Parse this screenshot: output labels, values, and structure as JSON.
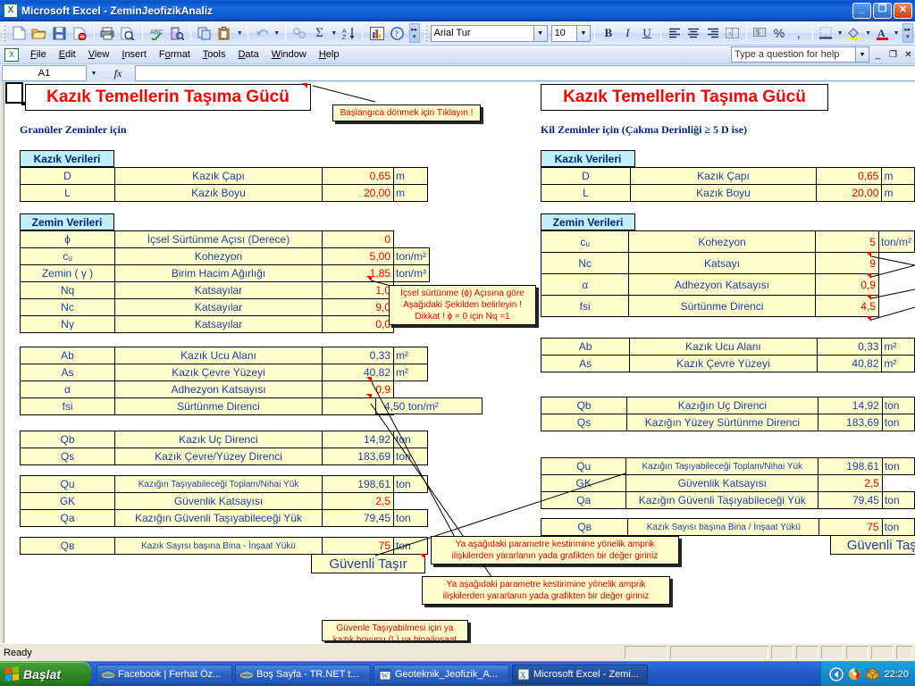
{
  "window": {
    "app_icon": "excel-icon",
    "title": "Microsoft Excel - ZeminJeofizikAnaliz",
    "minimize": "_",
    "restore": "❐",
    "close": "✕"
  },
  "toolbar": {
    "font_name": "Arial Tur",
    "font_size": "10",
    "bold": "B",
    "italic": "I",
    "underline": "U",
    "percent": "%",
    "comma": ",",
    "icons": [
      "new-document-icon",
      "open-folder-icon",
      "save-icon",
      "permission-icon",
      "print-icon",
      "print-preview-icon",
      "spelling-icon",
      "research-icon",
      "copy-icon",
      "paste-icon",
      "undo-icon",
      "hyperlink-icon",
      "autosum-icon",
      "sort-ascending-icon",
      "chart-wizard-icon",
      "help-icon"
    ]
  },
  "menubar": {
    "items": [
      {
        "label": "File",
        "accel": "F"
      },
      {
        "label": "Edit",
        "accel": "E"
      },
      {
        "label": "View",
        "accel": "V"
      },
      {
        "label": "Insert",
        "accel": "I"
      },
      {
        "label": "Format",
        "accel": "o"
      },
      {
        "label": "Tools",
        "accel": "T"
      },
      {
        "label": "Data",
        "accel": "D"
      },
      {
        "label": "Window",
        "accel": "W"
      },
      {
        "label": "Help",
        "accel": "H"
      }
    ],
    "ask_placeholder": "Type a question for help"
  },
  "formula_bar": {
    "name_box": "A1",
    "fx_label": "fx",
    "formula_value": ""
  },
  "sheet": {
    "left_panel": {
      "title": "Kazık Temellerin Taşıma Gücü",
      "subtitle": "Granüler Zeminler için",
      "pile_header": "Kazık Verileri",
      "pile_rows": [
        {
          "sym": "D",
          "desc": "Kazık Çapı",
          "val": "0,65",
          "unit": "m",
          "red": true
        },
        {
          "sym": "L",
          "desc": "Kazık Boyu",
          "val": "20,00",
          "unit": "m",
          "red": true
        }
      ],
      "soil_header": "Zemin Verileri",
      "soil_rows": [
        {
          "sym": "ϕ",
          "desc": "İçsel Sürtünme Açısı (Derece)",
          "val": "0",
          "unit": "",
          "red": true
        },
        {
          "sym": "cᵤ",
          "desc": "Kohezyon",
          "val": "5,00",
          "unit": "ton/m²",
          "red": true
        },
        {
          "sym": "Zemin ( γ )",
          "desc": "Birim Hacim Ağırlığı",
          "val": "1,85",
          "unit": "ton/m³",
          "red": true
        },
        {
          "sym": "Nq",
          "desc": "Katsayılar",
          "val": "1,0",
          "unit": "",
          "red": true
        },
        {
          "sym": "Nc",
          "desc": "Katsayılar",
          "val": "9,0",
          "unit": "",
          "red": true
        },
        {
          "sym": "Nγ",
          "desc": "Katsayılar",
          "val": "0,0",
          "unit": "",
          "red": true
        }
      ],
      "area_rows": [
        {
          "sym": "Ab",
          "desc": "Kazık Ucu Alanı",
          "val": "0,33",
          "unit": "m²",
          "red": false
        },
        {
          "sym": "As",
          "desc": "Kazık Çevre Yüzeyi",
          "val": "40,82",
          "unit": "m²",
          "red": false
        },
        {
          "sym": "α",
          "desc": "Adhezyon Katsayısı",
          "val": "0,9",
          "unit": "",
          "red": true
        },
        {
          "sym": "fsi",
          "desc": "Sürtünme Direnci",
          "val": "4,5",
          "unit": "",
          "red": true
        }
      ],
      "fsi_float": "4,50 ton/m²",
      "resist_rows": [
        {
          "sym": "Qb",
          "desc": "Kazık Uç Direnci",
          "val": "14,92",
          "unit": "ton",
          "red": false
        },
        {
          "sym": "Qs",
          "desc": "Kazık Çevre/Yüzey Direnci",
          "val": "183,69",
          "unit": "ton",
          "red": false
        }
      ],
      "capacity_rows": [
        {
          "sym": "Qu",
          "desc": "Kazığın Taşıyabileceği Toplam/Nihai Yük",
          "val": "198,61",
          "unit": "ton",
          "red": false,
          "small": true
        },
        {
          "sym": "GK",
          "desc": "Güvenlik Katsayısı",
          "val": "2,5",
          "unit": "",
          "red": true
        },
        {
          "sym": "Qa",
          "desc": "Kazığın Güvenli Taşıyabileceği Yük",
          "val": "79,45",
          "unit": "ton",
          "red": false
        }
      ],
      "building_row": {
        "sym": "Qʙ",
        "desc": "Kazık Sayısı başına Bina - İnşaat Yükü",
        "val": "75",
        "unit": "ton",
        "red": true,
        "small": true
      },
      "verdict": "Güvenli Taşır"
    },
    "right_panel": {
      "title": "Kazık Temellerin Taşıma Gücü",
      "subtitle": "Kil Zeminler için (Çakma Derinliği ≥ 5 D ise)",
      "pile_header": "Kazık Verileri",
      "pile_rows": [
        {
          "sym": "D",
          "desc": "Kazık Çapı",
          "val": "0,65",
          "unit": "m",
          "red": true
        },
        {
          "sym": "L",
          "desc": "Kazık Boyu",
          "val": "20,00",
          "unit": "m",
          "red": true
        }
      ],
      "soil_header": "Zemin Verileri",
      "soil_rows": [
        {
          "sym": "cᵤ",
          "desc": "Kohezyon",
          "val": "5",
          "unit": "ton/m²",
          "red": true
        },
        {
          "sym": "Nc",
          "desc": "Katsayı",
          "val": "9",
          "unit": "",
          "red": true
        },
        {
          "sym": "α",
          "desc": "Adhezyon Katsayısı",
          "val": "0,9",
          "unit": "",
          "red": true
        },
        {
          "sym": "fsi",
          "desc": "Sürtünme Direnci",
          "val": "4,5",
          "unit": "",
          "red": true
        }
      ],
      "area_rows": [
        {
          "sym": "Ab",
          "desc": "Kazık Ucu Alanı",
          "val": "0,33",
          "unit": "m²",
          "red": false
        },
        {
          "sym": "As",
          "desc": "Kazık Çevre Yüzeyi",
          "val": "40,82",
          "unit": "m²",
          "red": false
        }
      ],
      "resist_rows": [
        {
          "sym": "Qb",
          "desc": "Kazığın Uç Direnci",
          "val": "14,92",
          "unit": "ton",
          "red": false
        },
        {
          "sym": "Qs",
          "desc": "Kazığın Yüzey Sürtünme Direnci",
          "val": "183,69",
          "unit": "ton",
          "red": false
        }
      ],
      "capacity_rows": [
        {
          "sym": "Qu",
          "desc": "Kazığın Taşıyabileceği Toplam/Nihai Yük",
          "val": "198,61",
          "unit": "ton",
          "red": false,
          "small": true
        },
        {
          "sym": "GK",
          "desc": "Güvenlik Katsayısı",
          "val": "2,5",
          "unit": "",
          "red": true
        },
        {
          "sym": "Qa",
          "desc": "Kazığın Güvenli Taşıyabileceği Yük",
          "val": "79,45",
          "unit": "ton",
          "red": false
        }
      ],
      "building_row": {
        "sym": "Qʙ",
        "desc": "Kazık Sayısı başına Bina / İnşaat Yükü",
        "val": "75",
        "unit": "ton",
        "red": true,
        "small": true
      },
      "verdict": "Güvenli Taş..."
    },
    "callouts": {
      "back_to_start": "Başlangıca dönmek için Tıklayın !",
      "phi_note_line1": "İçsel sürtünme (ϕ) Açısına göre",
      "phi_note_line2": "Aşağıdaki Şekilden belirleyin !",
      "phi_note_line3": "Dikkat !  ϕ = 0 için Nq =1",
      "empiric_1_line1": "Ya aşağıdaki parametre kestirimine yönelik amprik",
      "empiric_1_line2": "ilişkilerden yararlanın yada grafikten bir değer giriniz",
      "empiric_2_line1": "Ya aşağıdaki parametre kestirimine yönelik amprik",
      "empiric_2_line2": "ilişkilerden yararlanın yada grafikten bir değer giriniz",
      "safe_note_line1": "Güvenle Taşıyabilmesi için ya",
      "safe_note_line2": "kazık boyunu (L) ya bina/inşaat"
    }
  },
  "status_bar": {
    "text": "Ready"
  },
  "taskbar": {
    "start_label": "Başlat",
    "items": [
      {
        "icon": "internet-explorer-icon",
        "label": "Facebook | Ferhat Öz...",
        "active": false
      },
      {
        "icon": "internet-explorer-icon",
        "label": "Boş Sayfa - TR.NET t...",
        "active": false
      },
      {
        "icon": "word-icon",
        "label": "Geoteknik_Jeofizik_A...",
        "active": false
      },
      {
        "icon": "excel-icon",
        "label": "Microsoft Excel - Zemi...",
        "active": true
      }
    ],
    "tray": {
      "show_hidden": "❮",
      "icons": [
        "media-icon",
        "package-icon"
      ],
      "clock": "22:20"
    }
  },
  "colors": {
    "title_bar": "#1464d8",
    "cell_fill": "#ffffcc",
    "header_fill": "#bff0f8",
    "label_blue": "#1f3da0",
    "value_red": "#e00000",
    "title_red": "#ff0000",
    "subtitle_blue": "#00237a",
    "taskbar_blue": "#1f5ec8",
    "start_green": "#2f8522"
  }
}
